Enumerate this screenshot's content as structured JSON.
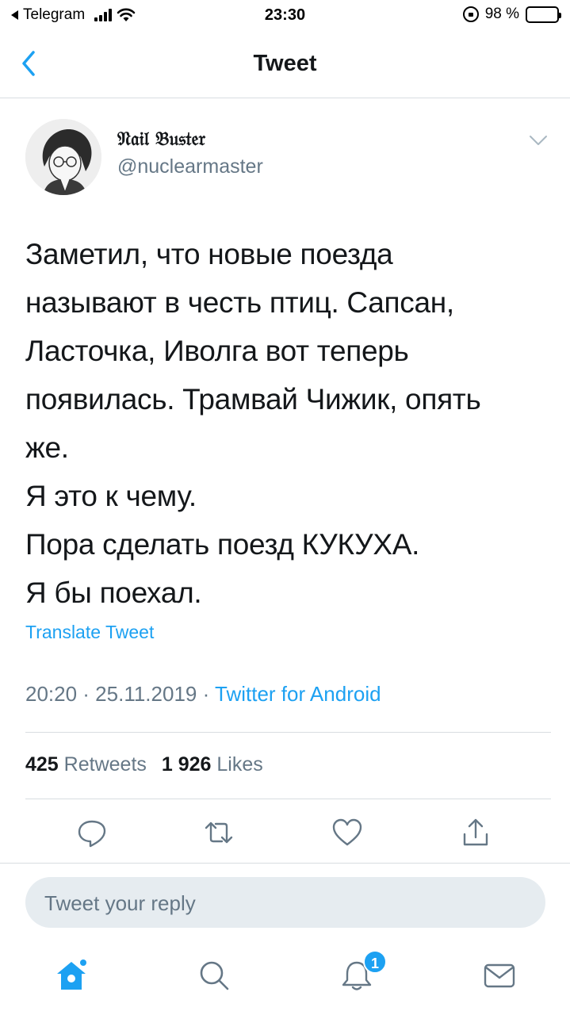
{
  "status_bar": {
    "back_app": "Telegram",
    "time": "23:30",
    "battery": "98 %"
  },
  "header": {
    "title": "Tweet"
  },
  "tweet": {
    "author_name": "𝔑𝔞𝔦𝔩 𝔅𝔲𝔰𝔱𝔢𝔯",
    "author_handle": "@nuclearmaster",
    "text_lines": [
      "Заметил, что новые поезда",
      "называют в честь птиц. Сапсан,",
      "Ласточка, Иволга вот теперь",
      "появилась. Трамвай Чижик, опять",
      "же.",
      "Я это к чему.",
      "Пора сделать поезд КУКУХА.",
      "Я бы поехал."
    ],
    "translate_label": "Translate Tweet",
    "timestamp": "20:20 · 25.11.2019 · ",
    "source": "Twitter for Android",
    "retweets_count": "425",
    "retweets_label": "Retweets",
    "likes_count": "1 926",
    "likes_label": "Likes"
  },
  "actions": {
    "icons": [
      "reply-icon",
      "retweet-icon",
      "like-icon",
      "share-icon"
    ]
  },
  "reply": {
    "placeholder": "Tweet your reply"
  },
  "tabbar": {
    "icons": [
      "home-icon",
      "search-icon",
      "notifications-icon",
      "messages-icon"
    ],
    "notification_badge": "1"
  },
  "colors": {
    "accent": "#1da1f2",
    "secondary_text": "#657786",
    "divider": "#d8dde1",
    "reply_bg": "#e6ecf0"
  }
}
